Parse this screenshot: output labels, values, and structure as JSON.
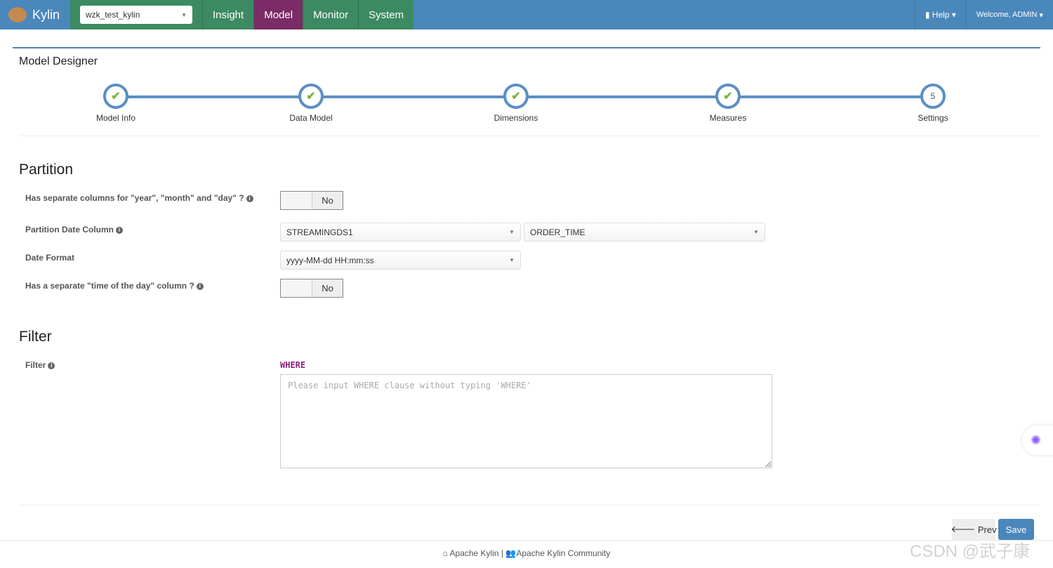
{
  "nav": {
    "brand": "Kylin",
    "project": "wzk_test_kylin",
    "tabs": [
      {
        "label": "Insight"
      },
      {
        "label": "Model",
        "active": true
      },
      {
        "label": "Monitor"
      },
      {
        "label": "System"
      }
    ],
    "help": "Help",
    "welcome": "Welcome, ADMIN"
  },
  "colors": {
    "navbar": "#4a87bb",
    "tab_bg": "#3c8a61",
    "active_tab": "#7b2b65",
    "step": "#5b8fc4",
    "check": "#7cb342"
  },
  "designer": {
    "title": "Model Designer",
    "steps": [
      {
        "label": "Model Info",
        "done": true
      },
      {
        "label": "Data Model",
        "done": true
      },
      {
        "label": "Dimensions",
        "done": true
      },
      {
        "label": "Measures",
        "done": true
      },
      {
        "label": "Settings",
        "done": false,
        "number": "5"
      }
    ]
  },
  "partition": {
    "heading": "Partition",
    "separate_columns_label": "Has separate columns for \"year\", \"month\" and \"day\" ?",
    "separate_columns_value": "No",
    "date_column_label": "Partition Date Column",
    "table": "STREAMINGDS1",
    "column": "ORDER_TIME",
    "date_format_label": "Date Format",
    "date_format": "yyyy-MM-dd HH:mm:ss",
    "time_column_label": "Has a separate \"time of the day\" column ?",
    "time_column_value": "No"
  },
  "filter": {
    "heading": "Filter",
    "label": "Filter",
    "keyword": "WHERE",
    "placeholder": "Please input WHERE clause without typing 'WHERE'",
    "value": ""
  },
  "buttons": {
    "prev": "Prev",
    "save": "Save"
  },
  "footer": {
    "left": "Apache Kylin",
    "sep": "|",
    "right": "Apache Kylin Community"
  },
  "watermark": "CSDN @武子康"
}
